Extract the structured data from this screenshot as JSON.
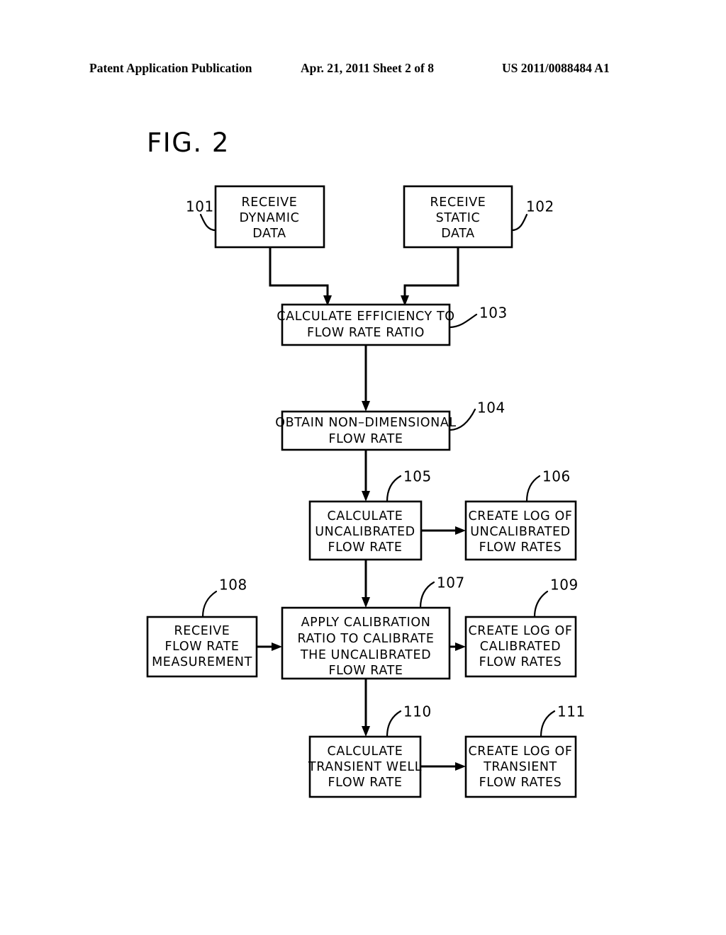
{
  "header": {
    "left": "Patent Application Publication",
    "middle": "Apr. 21, 2011  Sheet 2 of 8",
    "right": "US 2011/0088484 A1"
  },
  "figure": {
    "label": "FIG. 2",
    "type": "flowchart"
  },
  "nodes": [
    {
      "ref": "101",
      "lines": [
        "RECEIVE",
        "DYNAMIC",
        "DATA"
      ],
      "line1": "RECEIVE",
      "line2": "DYNAMIC",
      "line3": "DATA"
    },
    {
      "ref": "102",
      "lines": [
        "RECEIVE",
        "STATIC",
        "DATA"
      ],
      "line1": "RECEIVE",
      "line2": "STATIC",
      "line3": "DATA"
    },
    {
      "ref": "103",
      "lines": [
        "CALCULATE  EFFICIENCY  TO",
        "FLOW   RATE  RATIO"
      ],
      "line1": "CALCULATE  EFFICIENCY  TO",
      "line2": "FLOW   RATE  RATIO"
    },
    {
      "ref": "104",
      "lines": [
        "OBTAIN  NON–DIMENSIONAL",
        "FLOW   RATE"
      ],
      "line1": "OBTAIN  NON–DIMENSIONAL",
      "line2": "FLOW   RATE"
    },
    {
      "ref": "105",
      "lines": [
        "CALCULATE",
        "UNCALIBRATED",
        "FLOW   RATE"
      ],
      "line1": "CALCULATE",
      "line2": "UNCALIBRATED",
      "line3": "FLOW   RATE"
    },
    {
      "ref": "106",
      "lines": [
        "CREATE  LOG  OF",
        "UNCALIBRATED",
        "FLOW   RATES"
      ],
      "line1": "CREATE  LOG  OF",
      "line2": "UNCALIBRATED",
      "line3": "FLOW   RATES"
    },
    {
      "ref": "107",
      "lines": [
        "APPLY  CALIBRATION",
        "RATIO  TO  CALIBRATE",
        "THE  UNCALIBRATED",
        "FLOW   RATE"
      ],
      "line1": "APPLY  CALIBRATION",
      "line2": "RATIO  TO  CALIBRATE",
      "line3": "THE  UNCALIBRATED",
      "line4": "FLOW   RATE"
    },
    {
      "ref": "108",
      "lines": [
        "RECEIVE",
        "FLOW   RATE",
        "MEASUREMENT"
      ],
      "line1": "RECEIVE",
      "line2": "FLOW   RATE",
      "line3": "MEASUREMENT"
    },
    {
      "ref": "109",
      "lines": [
        "CREATE  LOG  OF",
        "CALIBRATED",
        "FLOW   RATES"
      ],
      "line1": "CREATE  LOG  OF",
      "line2": "CALIBRATED",
      "line3": "FLOW   RATES"
    },
    {
      "ref": "110",
      "lines": [
        "CALCULATE",
        "TRANSIENT  WELL",
        "FLOW   RATE"
      ],
      "line1": "CALCULATE",
      "line2": "TRANSIENT  WELL",
      "line3": "FLOW   RATE"
    },
    {
      "ref": "111",
      "lines": [
        "CREATE  LOG  OF",
        "TRANSIENT",
        "FLOW   RATES"
      ],
      "line1": "CREATE  LOG  OF",
      "line2": "TRANSIENT",
      "line3": "FLOW   RATES"
    }
  ],
  "refs": {
    "r101": "101",
    "r102": "102",
    "r103": "103",
    "r104": "104",
    "r105": "105",
    "r106": "106",
    "r107": "107",
    "r108": "108",
    "r109": "109",
    "r110": "110",
    "r111": "111"
  },
  "colors": {
    "ink": "#000000",
    "paper": "#ffffff"
  }
}
